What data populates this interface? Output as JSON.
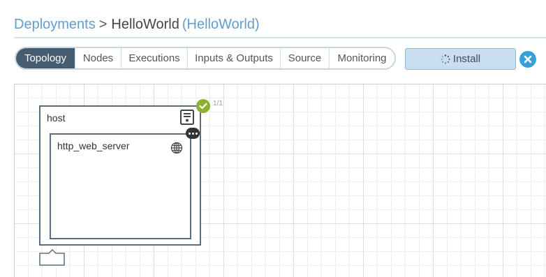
{
  "breadcrumb": {
    "root": "Deployments",
    "separator": ">",
    "title": "HelloWorld",
    "subtitle": "(HelloWorld)"
  },
  "tabs": [
    {
      "label": "Topology",
      "active": true
    },
    {
      "label": "Nodes",
      "active": false
    },
    {
      "label": "Executions",
      "active": false
    },
    {
      "label": "Inputs & Outputs",
      "active": false
    },
    {
      "label": "Source",
      "active": false
    },
    {
      "label": "Monitoring",
      "active": false
    }
  ],
  "actions": {
    "install_label": "Install",
    "install_icon": "spinner-icon",
    "close_icon": "close-icon"
  },
  "topology": {
    "host": {
      "name": "host",
      "icon": "server-icon",
      "instances": "1/1",
      "status": "success"
    },
    "child": {
      "name": "http_web_server",
      "icon": "globe-icon"
    }
  },
  "colors": {
    "link": "#5e9fce",
    "active_tab": "#465c6f",
    "install_bg": "#c9dff1",
    "close_btn": "#37a0d9",
    "status_ok": "#8cb22e",
    "node_border": "#5c6e7e"
  }
}
